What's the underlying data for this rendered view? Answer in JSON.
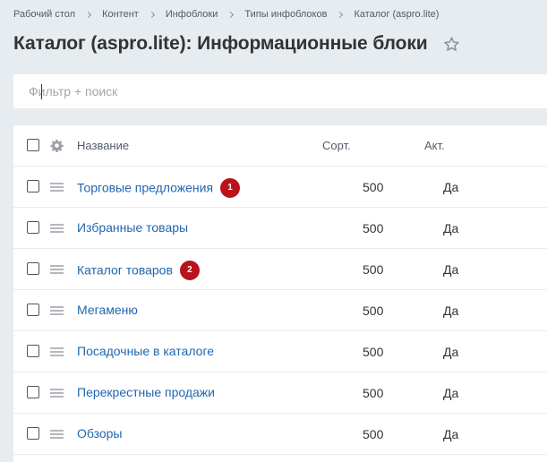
{
  "breadcrumb": [
    "Рабочий стол",
    "Контент",
    "Инфоблоки",
    "Типы инфоблоков",
    "Каталог (aspro.lite)"
  ],
  "page_title": "Каталог (aspro.lite): Информационные блоки",
  "filter": {
    "placeholder": "Фильтр + поиск",
    "value": ""
  },
  "columns": {
    "name": "Название",
    "sort": "Сорт.",
    "active": "Акт."
  },
  "rows": [
    {
      "name": "Торговые предложения",
      "sort": "500",
      "active": "Да",
      "badge": "1"
    },
    {
      "name": "Избранные товары",
      "sort": "500",
      "active": "Да",
      "badge": null
    },
    {
      "name": "Каталог товаров",
      "sort": "500",
      "active": "Да",
      "badge": "2"
    },
    {
      "name": "Мегаменю",
      "sort": "500",
      "active": "Да",
      "badge": null
    },
    {
      "name": "Посадочные в каталоге",
      "sort": "500",
      "active": "Да",
      "badge": null
    },
    {
      "name": "Перекрестные продажи",
      "sort": "500",
      "active": "Да",
      "badge": null
    },
    {
      "name": "Обзоры",
      "sort": "500",
      "active": "Да",
      "badge": null
    }
  ],
  "colors": {
    "link": "#2067b0",
    "badge": "#b9121b",
    "background": "#e6ecef"
  }
}
